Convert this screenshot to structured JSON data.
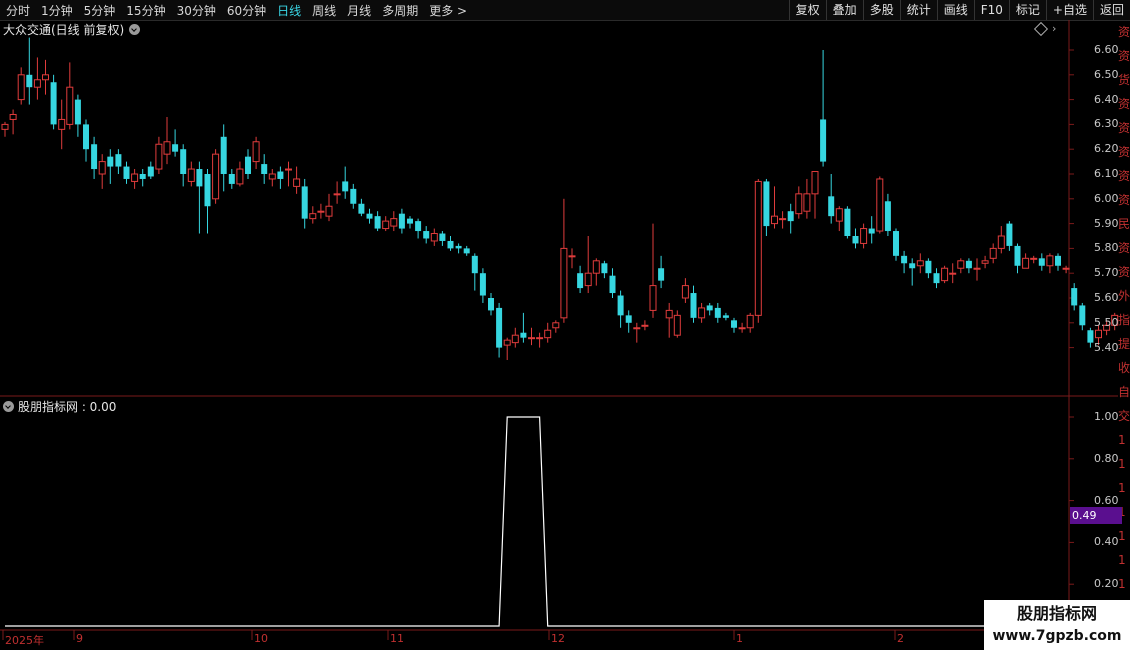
{
  "toolbar": {
    "periods": [
      "分时",
      "1分钟",
      "5分钟",
      "15分钟",
      "30分钟",
      "60分钟",
      "日线",
      "周线",
      "月线",
      "多周期",
      "更多 >"
    ],
    "active_period": "日线",
    "buttons": [
      "复权",
      "叠加",
      "多股",
      "统计",
      "画线",
      "F10",
      "标记",
      "+自选",
      "返回"
    ]
  },
  "stock": {
    "title": "大众交通(日线 前复权)"
  },
  "indicator": {
    "title": "股朋指标网 : 0.00",
    "highlight_value": "0.49"
  },
  "watermark": {
    "line1": "股朋指标网",
    "line2": "www.7gpzb.com"
  },
  "colors": {
    "up": "#e03c3c",
    "down": "#36d6e0",
    "axis": "#7a1a1a",
    "line": "#ffffff",
    "highlight": "#5a0f8f"
  },
  "chart_data": [
    {
      "type": "candlestick",
      "title": "大众交通(日线 前复权)",
      "y_ticks": [
        "6.60",
        "6.50",
        "6.40",
        "6.30",
        "6.20",
        "6.10",
        "6.00",
        "5.90",
        "5.80",
        "5.70",
        "5.60",
        "5.50",
        "5.40"
      ],
      "x_labels": [
        "2025年",
        "9",
        "10",
        "11",
        "12",
        "1",
        "2"
      ],
      "candles": [
        [
          6.28,
          6.3,
          6.25,
          6.31
        ],
        [
          6.32,
          6.34,
          6.26,
          6.36
        ],
        [
          6.4,
          6.5,
          6.38,
          6.53
        ],
        [
          6.5,
          6.45,
          6.38,
          6.65
        ],
        [
          6.45,
          6.48,
          6.4,
          6.57
        ],
        [
          6.48,
          6.5,
          6.42,
          6.56
        ],
        [
          6.47,
          6.3,
          6.28,
          6.5
        ],
        [
          6.28,
          6.32,
          6.2,
          6.4
        ],
        [
          6.3,
          6.45,
          6.28,
          6.55
        ],
        [
          6.4,
          6.3,
          6.25,
          6.42
        ],
        [
          6.3,
          6.2,
          6.15,
          6.32
        ],
        [
          6.22,
          6.12,
          6.08,
          6.25
        ],
        [
          6.1,
          6.15,
          6.04,
          6.18
        ],
        [
          6.17,
          6.13,
          6.06,
          6.2
        ],
        [
          6.18,
          6.13,
          6.1,
          6.2
        ],
        [
          6.13,
          6.08,
          6.06,
          6.15
        ],
        [
          6.07,
          6.1,
          6.04,
          6.12
        ],
        [
          6.1,
          6.08,
          6.05,
          6.12
        ],
        [
          6.13,
          6.09,
          6.08,
          6.15
        ],
        [
          6.12,
          6.22,
          6.1,
          6.25
        ],
        [
          6.18,
          6.23,
          6.14,
          6.33
        ],
        [
          6.22,
          6.19,
          6.17,
          6.28
        ],
        [
          6.2,
          6.1,
          6.05,
          6.22
        ],
        [
          6.07,
          6.12,
          6.05,
          6.15
        ],
        [
          6.12,
          6.05,
          5.86,
          6.15
        ],
        [
          6.1,
          5.97,
          5.86,
          6.12
        ],
        [
          6.0,
          6.18,
          5.98,
          6.2
        ],
        [
          6.25,
          6.1,
          6.03,
          6.3
        ],
        [
          6.1,
          6.06,
          6.04,
          6.12
        ],
        [
          6.06,
          6.12,
          6.05,
          6.15
        ],
        [
          6.17,
          6.1,
          6.08,
          6.2
        ],
        [
          6.15,
          6.23,
          6.12,
          6.25
        ],
        [
          6.14,
          6.1,
          6.06,
          6.18
        ],
        [
          6.08,
          6.1,
          6.05,
          6.12
        ],
        [
          6.11,
          6.08,
          6.04,
          6.13
        ],
        [
          6.12,
          6.12,
          6.05,
          6.15
        ],
        [
          6.05,
          6.08,
          6.02,
          6.13
        ],
        [
          6.05,
          5.92,
          5.88,
          6.08
        ],
        [
          5.92,
          5.94,
          5.9,
          5.97
        ],
        [
          5.95,
          5.95,
          5.92,
          5.98
        ],
        [
          5.93,
          5.97,
          5.91,
          6.02
        ],
        [
          6.02,
          6.02,
          5.98,
          6.07
        ],
        [
          6.07,
          6.03,
          6.0,
          6.13
        ],
        [
          6.04,
          5.98,
          5.96,
          6.06
        ],
        [
          5.98,
          5.94,
          5.93,
          6.0
        ],
        [
          5.94,
          5.92,
          5.9,
          5.96
        ],
        [
          5.93,
          5.88,
          5.87,
          5.95
        ],
        [
          5.88,
          5.91,
          5.87,
          5.93
        ],
        [
          5.89,
          5.92,
          5.87,
          5.95
        ],
        [
          5.94,
          5.88,
          5.86,
          5.96
        ],
        [
          5.92,
          5.9,
          5.88,
          5.93
        ],
        [
          5.91,
          5.87,
          5.84,
          5.92
        ],
        [
          5.87,
          5.84,
          5.82,
          5.89
        ],
        [
          5.83,
          5.86,
          5.81,
          5.88
        ],
        [
          5.86,
          5.83,
          5.81,
          5.87
        ],
        [
          5.83,
          5.8,
          5.79,
          5.85
        ],
        [
          5.81,
          5.8,
          5.78,
          5.82
        ],
        [
          5.8,
          5.78,
          5.77,
          5.81
        ],
        [
          5.77,
          5.7,
          5.63,
          5.78
        ],
        [
          5.7,
          5.61,
          5.58,
          5.72
        ],
        [
          5.6,
          5.55,
          5.53,
          5.62
        ],
        [
          5.56,
          5.4,
          5.36,
          5.58
        ],
        [
          5.41,
          5.43,
          5.35,
          5.44
        ],
        [
          5.42,
          5.45,
          5.4,
          5.48
        ],
        [
          5.46,
          5.44,
          5.42,
          5.54
        ],
        [
          5.44,
          5.44,
          5.41,
          5.48
        ],
        [
          5.44,
          5.44,
          5.4,
          5.46
        ],
        [
          5.44,
          5.47,
          5.42,
          5.5
        ],
        [
          5.48,
          5.5,
          5.46,
          5.51
        ],
        [
          5.52,
          5.8,
          5.5,
          6.0
        ],
        [
          5.77,
          5.77,
          5.72,
          5.8
        ],
        [
          5.7,
          5.64,
          5.62,
          5.73
        ],
        [
          5.65,
          5.7,
          5.62,
          5.85
        ],
        [
          5.7,
          5.75,
          5.65,
          5.76
        ],
        [
          5.74,
          5.7,
          5.68,
          5.75
        ],
        [
          5.69,
          5.62,
          5.6,
          5.72
        ],
        [
          5.61,
          5.53,
          5.48,
          5.63
        ],
        [
          5.53,
          5.5,
          5.46,
          5.55
        ],
        [
          5.48,
          5.48,
          5.42,
          5.5
        ],
        [
          5.49,
          5.49,
          5.47,
          5.51
        ],
        [
          5.55,
          5.65,
          5.52,
          5.9
        ],
        [
          5.72,
          5.67,
          5.64,
          5.77
        ],
        [
          5.52,
          5.55,
          5.44,
          5.58
        ],
        [
          5.45,
          5.53,
          5.44,
          5.55
        ],
        [
          5.6,
          5.65,
          5.58,
          5.68
        ],
        [
          5.62,
          5.52,
          5.5,
          5.65
        ],
        [
          5.52,
          5.56,
          5.5,
          5.58
        ],
        [
          5.57,
          5.55,
          5.53,
          5.58
        ],
        [
          5.56,
          5.52,
          5.5,
          5.58
        ],
        [
          5.53,
          5.52,
          5.51,
          5.54
        ],
        [
          5.51,
          5.48,
          5.46,
          5.52
        ],
        [
          5.48,
          5.48,
          5.46,
          5.5
        ],
        [
          5.48,
          5.53,
          5.46,
          5.54
        ],
        [
          5.53,
          6.07,
          5.5,
          6.08
        ],
        [
          6.07,
          5.89,
          5.85,
          6.08
        ],
        [
          5.9,
          5.93,
          5.88,
          6.05
        ],
        [
          5.92,
          5.92,
          5.88,
          5.95
        ],
        [
          5.95,
          5.91,
          5.86,
          5.98
        ],
        [
          5.94,
          6.02,
          5.92,
          6.05
        ],
        [
          5.95,
          6.02,
          5.92,
          6.08
        ],
        [
          6.02,
          6.11,
          5.92,
          6.11
        ],
        [
          6.32,
          6.15,
          6.13,
          6.6
        ],
        [
          6.01,
          5.93,
          5.9,
          6.1
        ],
        [
          5.91,
          5.96,
          5.87,
          5.97
        ],
        [
          5.96,
          5.85,
          5.84,
          5.97
        ],
        [
          5.85,
          5.82,
          5.8,
          5.88
        ],
        [
          5.82,
          5.88,
          5.8,
          5.9
        ],
        [
          5.88,
          5.86,
          5.82,
          5.93
        ],
        [
          5.87,
          6.08,
          5.86,
          6.09
        ],
        [
          5.99,
          5.87,
          5.85,
          6.02
        ],
        [
          5.87,
          5.77,
          5.75,
          5.88
        ],
        [
          5.77,
          5.74,
          5.7,
          5.79
        ],
        [
          5.74,
          5.72,
          5.65,
          5.76
        ],
        [
          5.73,
          5.75,
          5.7,
          5.78
        ],
        [
          5.75,
          5.7,
          5.68,
          5.76
        ],
        [
          5.7,
          5.66,
          5.64,
          5.72
        ],
        [
          5.67,
          5.72,
          5.66,
          5.73
        ],
        [
          5.7,
          5.7,
          5.66,
          5.74
        ],
        [
          5.72,
          5.75,
          5.7,
          5.76
        ],
        [
          5.75,
          5.72,
          5.7,
          5.76
        ],
        [
          5.72,
          5.72,
          5.67,
          5.76
        ],
        [
          5.74,
          5.75,
          5.72,
          5.77
        ],
        [
          5.76,
          5.8,
          5.74,
          5.82
        ],
        [
          5.8,
          5.85,
          5.78,
          5.89
        ],
        [
          5.9,
          5.81,
          5.79,
          5.91
        ],
        [
          5.81,
          5.73,
          5.7,
          5.82
        ],
        [
          5.72,
          5.76,
          5.72,
          5.78
        ],
        [
          5.76,
          5.76,
          5.74,
          5.77
        ],
        [
          5.76,
          5.73,
          5.71,
          5.78
        ],
        [
          5.73,
          5.77,
          5.7,
          5.78
        ],
        [
          5.77,
          5.73,
          5.71,
          5.78
        ],
        [
          5.72,
          5.72,
          5.7,
          5.73
        ],
        [
          5.64,
          5.57,
          5.55,
          5.66
        ],
        [
          5.57,
          5.49,
          5.47,
          5.58
        ],
        [
          5.47,
          5.42,
          5.4,
          5.48
        ],
        [
          5.44,
          5.47,
          5.41,
          5.49
        ],
        [
          5.47,
          5.49,
          5.45,
          5.51
        ],
        [
          5.49,
          5.53,
          5.47,
          5.54
        ]
      ]
    },
    {
      "type": "line",
      "title": "股朋指标网 : 0.00",
      "y_ticks": [
        "1.00",
        "0.80",
        "0.60",
        "0.40",
        "0.20"
      ],
      "ylim": [
        0,
        1.0
      ],
      "spikes": [
        {
          "start_index": 62,
          "end_index": 64,
          "value": 1.0
        },
        {
          "start_index": 65,
          "end_index": 66,
          "value": 1.0
        }
      ],
      "n_points": 128
    }
  ]
}
